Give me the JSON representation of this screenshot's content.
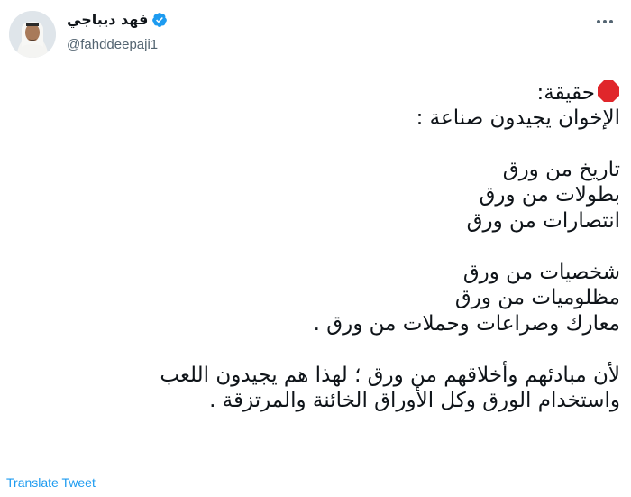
{
  "author": {
    "display_name": "فهد ديباجي",
    "handle": "@fahddeepaji1",
    "verified": true
  },
  "icons": {
    "avatar": "profile-photo",
    "verified": "verified-badge-icon",
    "more": "more-options-icon",
    "stop_emoji": "stop-sign-emoji"
  },
  "colors": {
    "accent": "#1d9bf0",
    "secondary_text": "#536471",
    "stop_red": "#e0262b"
  },
  "tweet": {
    "lines": [
      "حقيقة:",
      "الإخوان يجيدون صناعة :",
      "",
      "تاريخ من ورق",
      "بطولات من ورق",
      "انتصارات من ورق",
      "",
      "شخصيات من ورق",
      "مظلوميات من ورق",
      "معارك وصراعات وحملات من ورق .",
      "",
      "لأن مبادئهم وأخلاقهم من ورق ؛ لهذا هم يجيدون اللعب",
      "واستخدام الورق وكل الأوراق الخائنة والمرتزقة ."
    ]
  },
  "translate_label": "Translate Tweet"
}
